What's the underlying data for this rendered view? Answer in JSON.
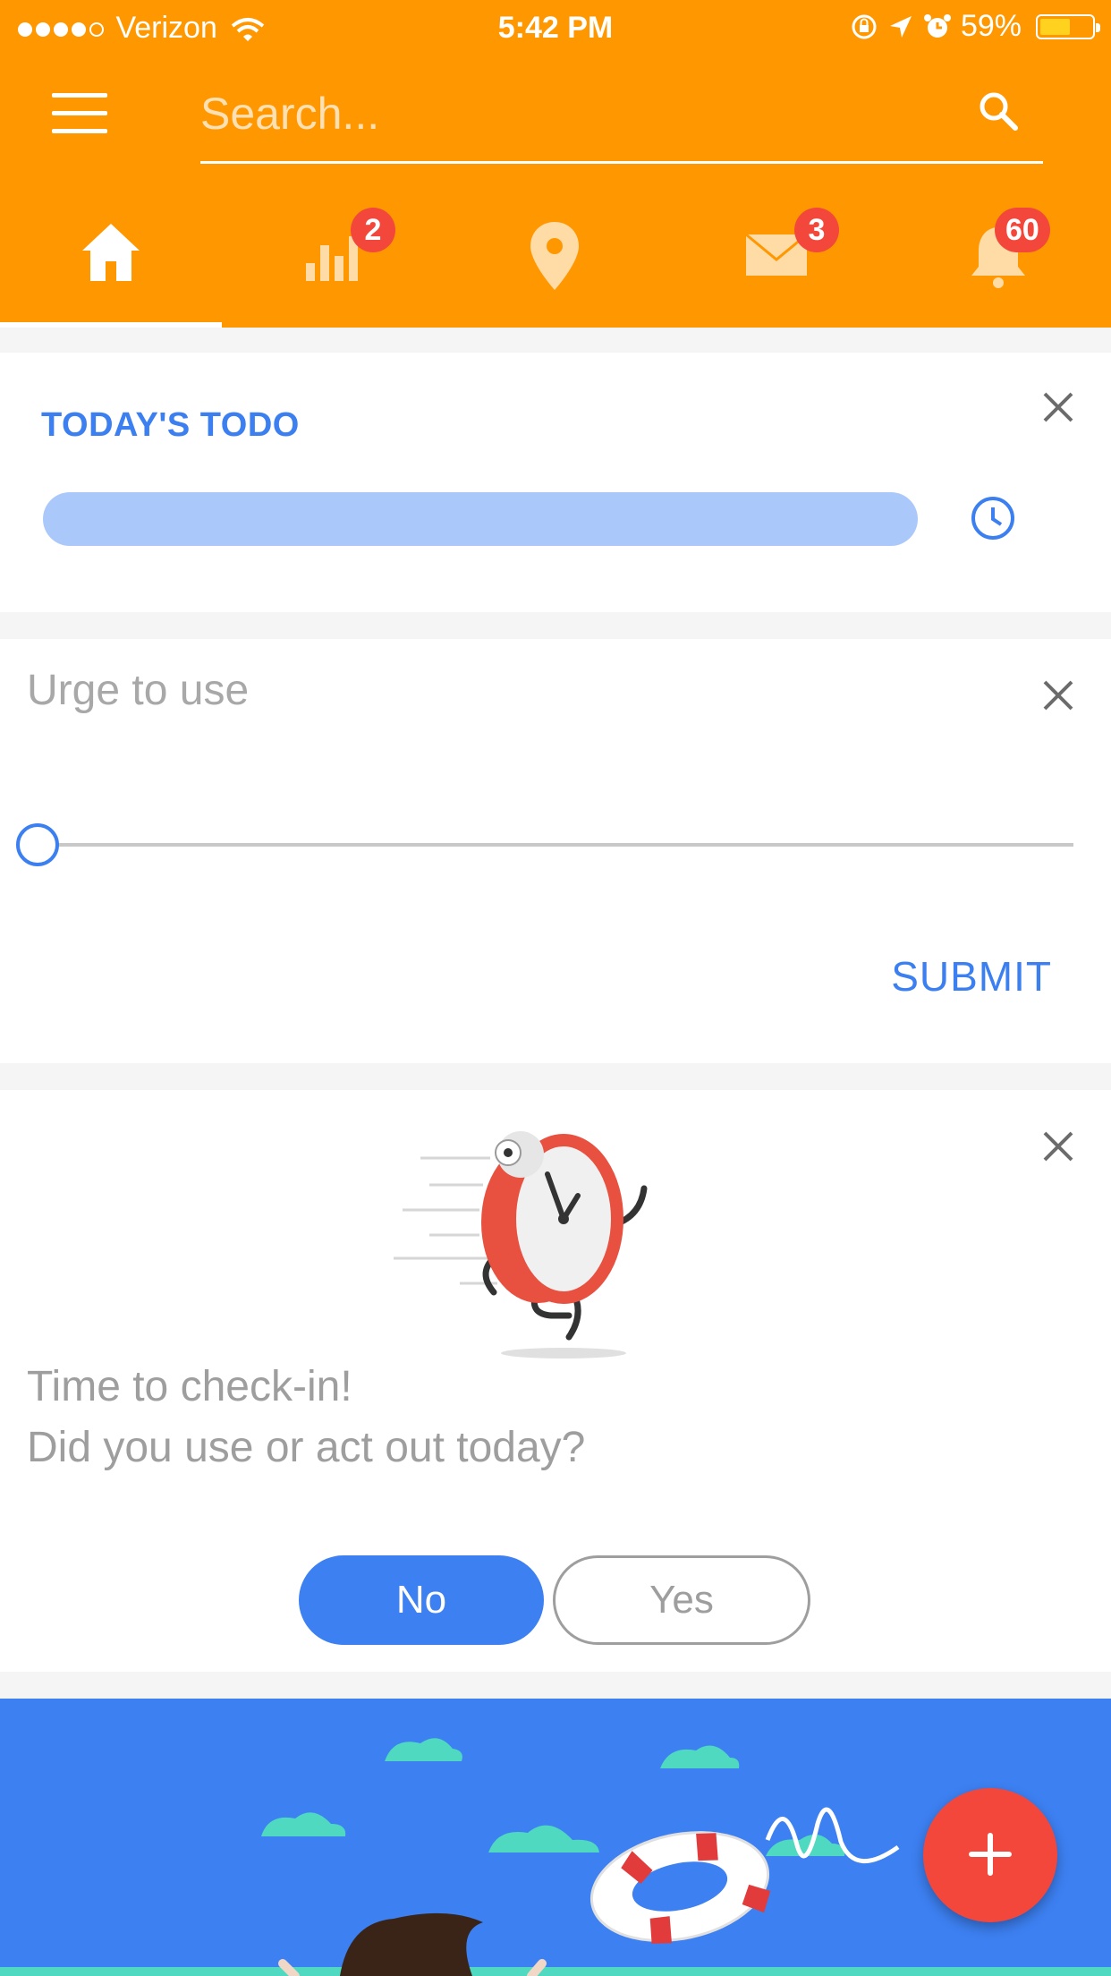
{
  "status_bar": {
    "carrier": "Verizon",
    "time": "5:42 PM",
    "battery": "59%",
    "battery_level": 0.59
  },
  "search": {
    "placeholder": "Search..."
  },
  "tabs": [
    {
      "name": "home",
      "badge": ""
    },
    {
      "name": "stats",
      "badge": "2"
    },
    {
      "name": "location",
      "badge": ""
    },
    {
      "name": "messages",
      "badge": "3"
    },
    {
      "name": "notifications",
      "badge": "60"
    }
  ],
  "todo_card": {
    "title": "TODAY'S TODO"
  },
  "urge_card": {
    "title": "Urge to use",
    "submit_label": "SUBMIT",
    "slider_value": 0
  },
  "checkin_card": {
    "line1": "Time to check-in!",
    "line2": "Did you use or act out today?",
    "no_label": "No",
    "yes_label": "Yes"
  },
  "colors": {
    "header": "#ff9800",
    "accent": "#3d80f2",
    "badge": "#f4473b",
    "progress": "#abc8fb"
  }
}
